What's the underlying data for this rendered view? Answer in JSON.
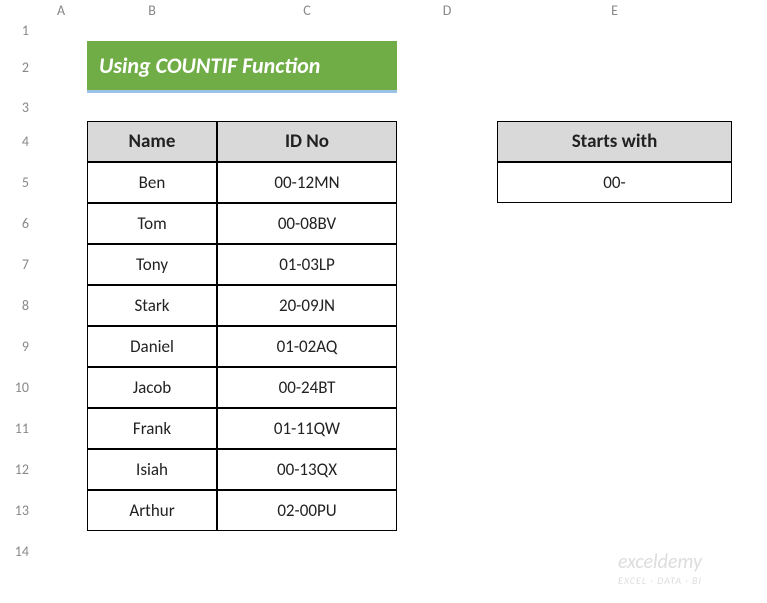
{
  "cols": [
    "A",
    "B",
    "C",
    "D",
    "E"
  ],
  "rows": [
    "1",
    "2",
    "3",
    "4",
    "5",
    "6",
    "7",
    "8",
    "9",
    "10",
    "11",
    "12",
    "13",
    "14"
  ],
  "title": "Using COUNTIF Function",
  "table1": {
    "headers": {
      "name": "Name",
      "id": "ID No"
    },
    "rows": [
      {
        "name": "Ben",
        "id": "00-12MN"
      },
      {
        "name": "Tom",
        "id": "00-08BV"
      },
      {
        "name": "Tony",
        "id": "01-03LP"
      },
      {
        "name": "Stark",
        "id": "20-09JN"
      },
      {
        "name": "Daniel",
        "id": "01-02AQ"
      },
      {
        "name": "Jacob",
        "id": "00-24BT"
      },
      {
        "name": "Frank",
        "id": "01-11QW"
      },
      {
        "name": "Isiah",
        "id": "00-13QX"
      },
      {
        "name": "Arthur",
        "id": "02-00PU"
      }
    ]
  },
  "table2": {
    "header": "Starts with",
    "value": "00-"
  },
  "watermark": {
    "line1": "exceldemy",
    "line2": "EXCEL · DATA · BI"
  }
}
